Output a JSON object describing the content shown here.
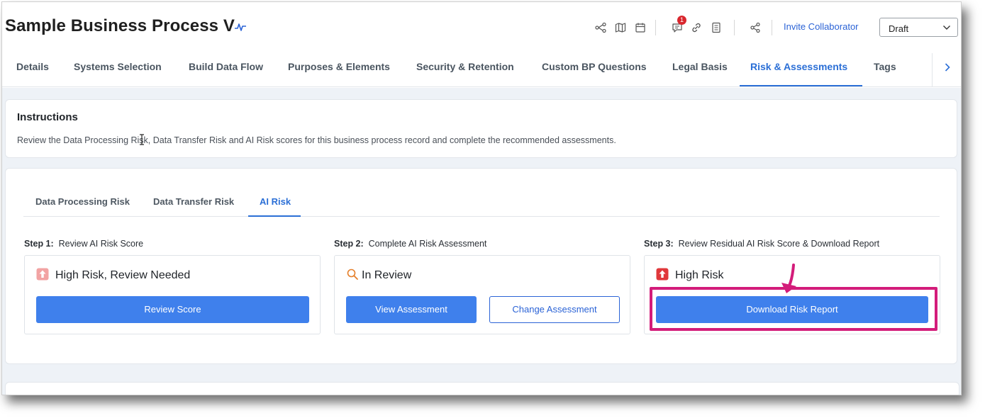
{
  "header": {
    "title": "Sample Business Process V",
    "notification_count": "1",
    "invite_label": "Invite Collaborator",
    "status_select": "Draft"
  },
  "tabs": [
    {
      "label": "Details"
    },
    {
      "label": "Systems Selection"
    },
    {
      "label": "Build Data Flow"
    },
    {
      "label": "Purposes & Elements"
    },
    {
      "label": "Security & Retention"
    },
    {
      "label": "Custom BP Questions"
    },
    {
      "label": "Legal Basis"
    },
    {
      "label": "Risk & Assessments"
    },
    {
      "label": "Tags"
    }
  ],
  "instructions": {
    "title": "Instructions",
    "text": "Review the Data Processing Risk, Data Transfer Risk and AI Risk scores for this business process record and complete the recommended assessments."
  },
  "risk_tabs": [
    {
      "label": "Data Processing Risk"
    },
    {
      "label": "Data Transfer Risk"
    },
    {
      "label": "AI Risk"
    }
  ],
  "steps": [
    {
      "step": "Step 1:",
      "title": "Review AI Risk Score",
      "status": "High Risk, Review Needed",
      "buttons": [
        "Review Score"
      ]
    },
    {
      "step": "Step 2:",
      "title": "Complete AI Risk Assessment",
      "status": "In Review",
      "buttons": [
        "View Assessment",
        "Change Assessment"
      ]
    },
    {
      "step": "Step 3:",
      "title": "Review Residual AI Risk Score & Download Report",
      "status": "High Risk",
      "buttons": [
        "Download Risk Report"
      ]
    }
  ],
  "colors": {
    "accent": "#2b6fd6",
    "primary_button": "#3f80ec",
    "highlight": "#d31c7a",
    "risk_red": "#e0383b",
    "risk_light": "#f2a3a3",
    "review_orange": "#e57f2a"
  }
}
